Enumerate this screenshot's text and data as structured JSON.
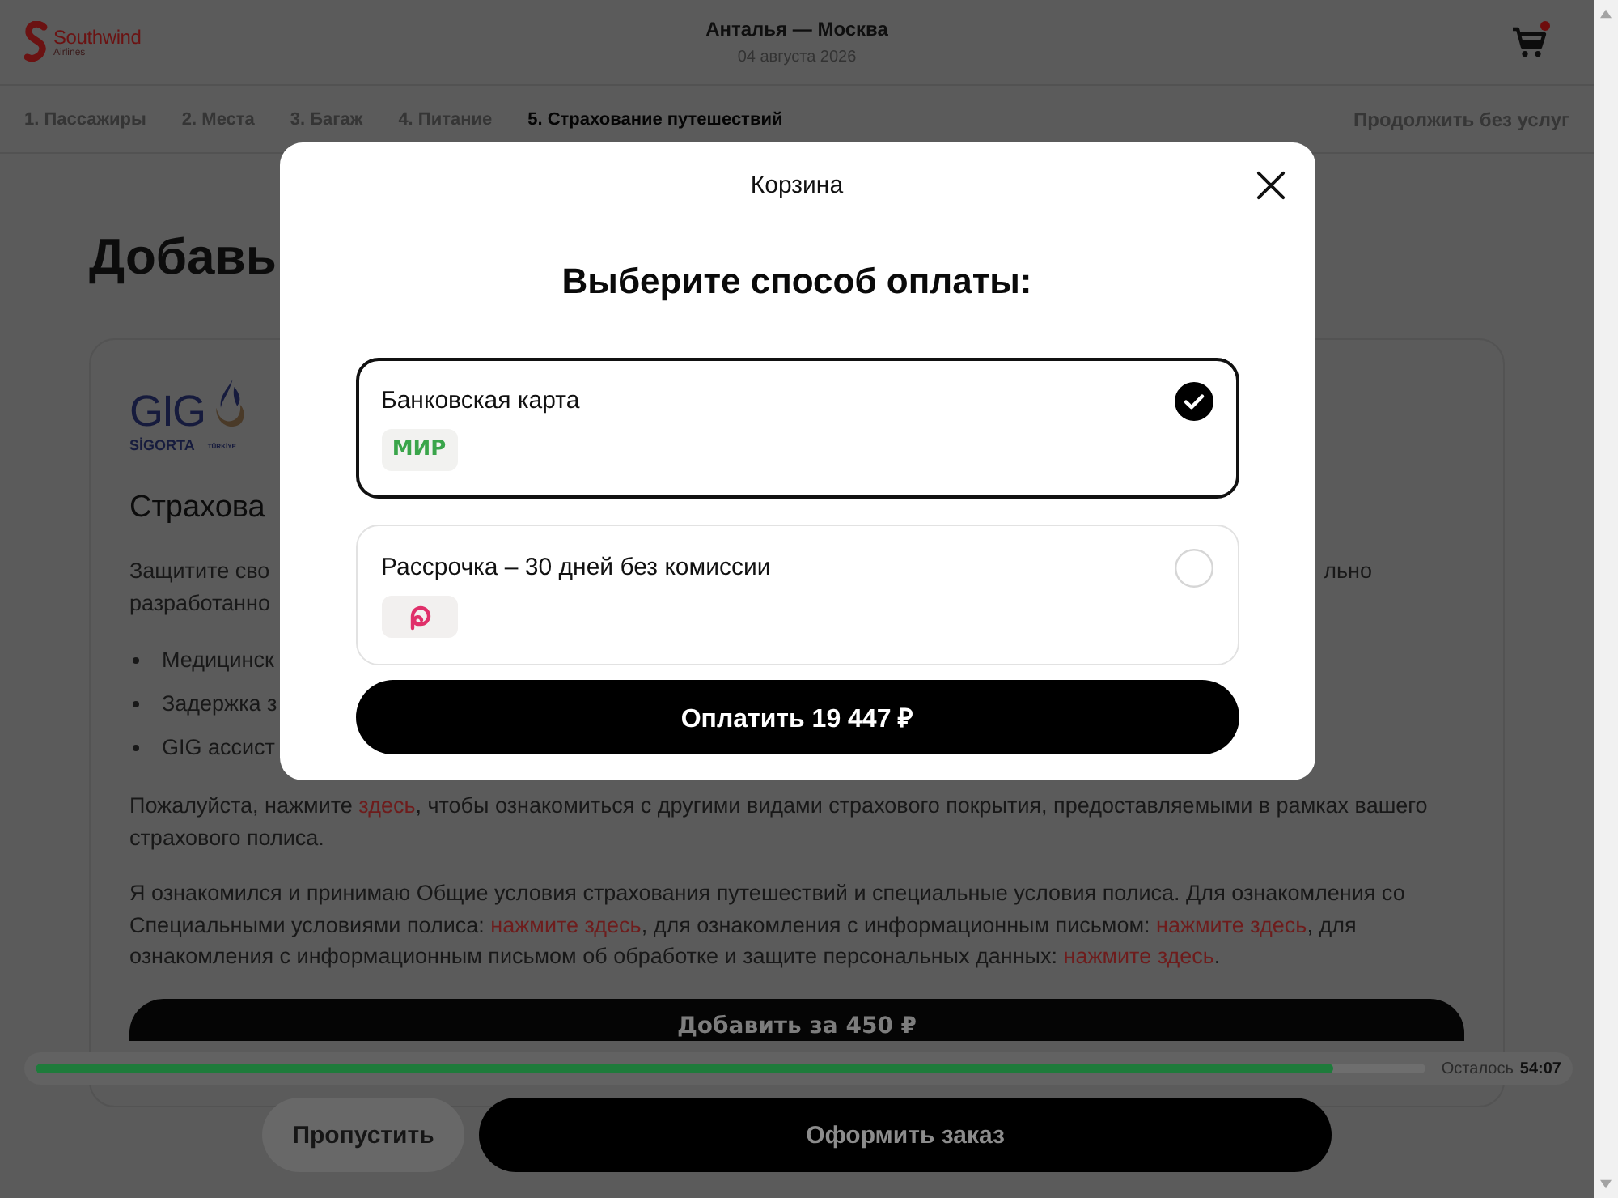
{
  "header": {
    "logo": {
      "name": "Southwind",
      "subtitle": "Airlines"
    },
    "route": "Анталья — Москва",
    "date": "04 августа 2026",
    "cart": {
      "has_items": true
    }
  },
  "steps": [
    {
      "label": "1. Пассажиры",
      "selected": false
    },
    {
      "label": "2. Места",
      "selected": false
    },
    {
      "label": "3. Багаж",
      "selected": false
    },
    {
      "label": "4. Питание",
      "selected": false
    },
    {
      "label": "5. Страхование путешествий",
      "selected": true
    }
  ],
  "skip_services_link": "Продолжить без услуг",
  "page_heading": "Добавь",
  "insurance_card": {
    "provider_logo": {
      "name": "GIG",
      "subtitle": "SİGORTA",
      "country": "TÜRKİYE"
    },
    "title": "Страхова",
    "intro_lines": [
      {
        "left": "Защитите сво",
        "right": "льно"
      },
      {
        "left": "разработанно"
      }
    ],
    "bullets": [
      "Медицинск",
      "Задержка з",
      "GIG ассист"
    ],
    "coverage_note": [
      {
        "kind": "text",
        "text": "Пожалуйста, нажмите "
      },
      {
        "kind": "link",
        "text": "здесь"
      },
      {
        "kind": "text",
        "text": ", чтобы ознакомиться с другими видами страхового покрытия, предоставляемыми в рамках вашего страхового полиса."
      }
    ],
    "consent_note": [
      {
        "kind": "text",
        "text": "Я ознакомился и принимаю Общие условия страхования путешествий и специальные условия полиса. Для ознакомления со Специальными условиями полиса: "
      },
      {
        "kind": "link",
        "text": "нажмите здесь"
      },
      {
        "kind": "text",
        "text": ", для ознакомления с информационным письмом: "
      },
      {
        "kind": "link",
        "text": "нажмите здесь"
      },
      {
        "kind": "text",
        "text": ", для ознакомления с информационным письмом об обработке и защите персональных данных: "
      },
      {
        "kind": "link",
        "text": "нажмите здесь"
      },
      {
        "kind": "text",
        "text": "."
      }
    ],
    "add_button": "Добавить за 450 ₽"
  },
  "timer": {
    "level": 0.934,
    "label": "Осталось",
    "time": "54:07"
  },
  "footer_buttons": [
    {
      "label": "Пропустить",
      "kind": "secondary"
    },
    {
      "label": "Оформить заказ",
      "kind": "primary"
    }
  ],
  "modal": {
    "title": "Корзина",
    "heading": "Выберите способ оплаты:",
    "payment_methods": [
      {
        "label": "Банковская карта",
        "kind": "card",
        "logo_text": "МИР",
        "selected": true
      },
      {
        "label": "Рассрочка – 30 дней без комиссии",
        "kind": "installment",
        "selected": false
      }
    ],
    "pay_button": "Оплатить 19 447 ₽"
  }
}
